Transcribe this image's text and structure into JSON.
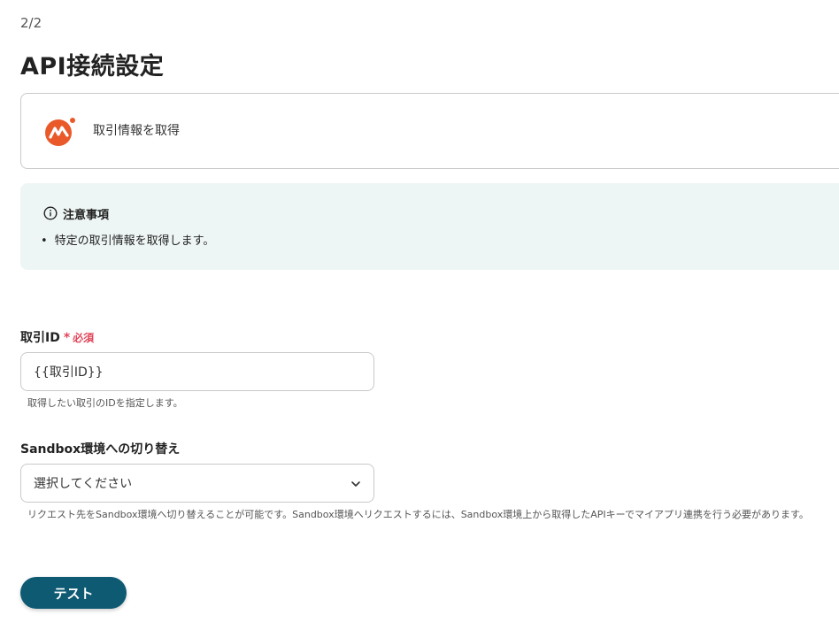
{
  "header": {
    "step": "2/2",
    "title": "API接続設定"
  },
  "app_card": {
    "icon": "money-forward-logo",
    "action": "取引情報を取得"
  },
  "notice": {
    "icon": "info-circle-icon",
    "title": "注意事項",
    "items": [
      "特定の取引情報を取得します。"
    ]
  },
  "fields": {
    "transaction_id": {
      "label": "取引ID",
      "required_label": "必須",
      "value": "{{取引ID}}",
      "help": "取得したい取引のIDを指定します。"
    },
    "sandbox": {
      "label": "Sandbox環境への切り替え",
      "placeholder": "選択してください",
      "help": "リクエスト先をSandbox環境へ切り替えることが可能です。Sandbox環境へリクエストするには、Sandbox環境上から取得したAPIキーでマイアプリ連携を行う必要があります。"
    }
  },
  "actions": {
    "test_label": "テスト"
  },
  "colors": {
    "primary_button": "#0e5a73",
    "required": "#e0475b",
    "notice_bg": "#eef6f5",
    "logo": "#e9592a"
  }
}
